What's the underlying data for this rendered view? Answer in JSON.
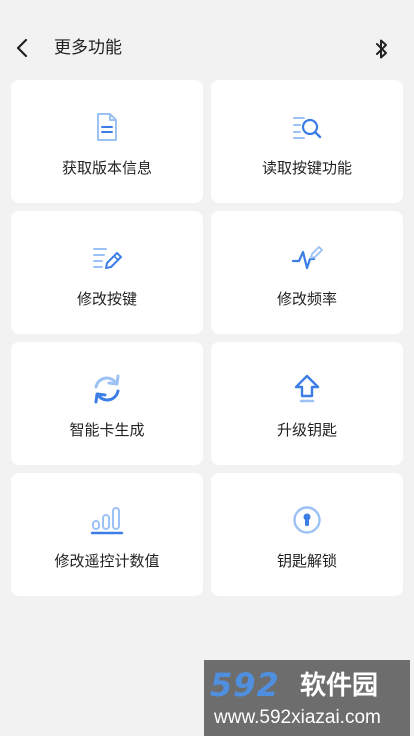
{
  "header": {
    "title": "更多功能",
    "back_icon": "chevron-left-icon",
    "bluetooth_icon": "bluetooth-icon"
  },
  "colors": {
    "accent": "#3d7ee6",
    "accent_light": "#9cc2f5",
    "card_bg": "#ffffff",
    "page_bg": "#f2f2f2"
  },
  "cards": [
    {
      "label": "获取版本信息",
      "icon": "document-icon"
    },
    {
      "label": "读取按键功能",
      "icon": "list-search-icon"
    },
    {
      "label": "修改按键",
      "icon": "list-edit-icon"
    },
    {
      "label": "修改频率",
      "icon": "pulse-edit-icon"
    },
    {
      "label": "智能卡生成",
      "icon": "refresh-icon"
    },
    {
      "label": "升级钥匙",
      "icon": "upload-arrow-icon"
    },
    {
      "label": "修改遥控计数值",
      "icon": "bar-signal-icon"
    },
    {
      "label": "钥匙解锁",
      "icon": "keyhole-icon"
    }
  ],
  "watermark": {
    "logo": "592",
    "brand": "软件园",
    "url": "www.592xiazai.com"
  }
}
